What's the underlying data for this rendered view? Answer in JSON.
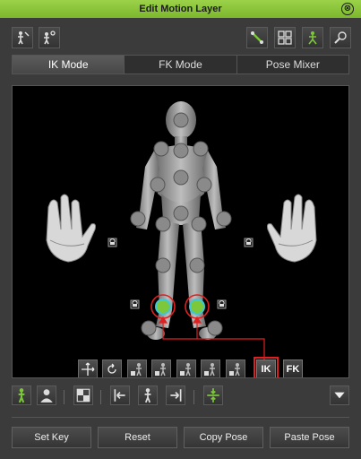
{
  "window": {
    "title": "Edit Motion Layer",
    "close_glyph": "⊗"
  },
  "toolbar_left": [
    {
      "icon": "figure-pin-icon"
    },
    {
      "icon": "figure-key-icon"
    }
  ],
  "toolbar_right": [
    {
      "icon": "bone-icon"
    },
    {
      "icon": "grid-select-icon"
    },
    {
      "icon": "figure-effector-icon"
    },
    {
      "icon": "search-figure-icon"
    }
  ],
  "tabs": [
    {
      "label": "IK Mode",
      "active": true
    },
    {
      "label": "FK Mode",
      "active": false
    },
    {
      "label": "Pose Mixer",
      "active": false
    }
  ],
  "viewport": {
    "mode_buttons": {
      "ik": "IK",
      "fk": "FK",
      "active": "IK"
    },
    "accent_color": "#7cc83a",
    "highlight_color": "#e02020"
  },
  "bottom_buttons": {
    "set_key": "Set Key",
    "reset": "Reset",
    "copy_pose": "Copy Pose",
    "paste_pose": "Paste Pose"
  }
}
